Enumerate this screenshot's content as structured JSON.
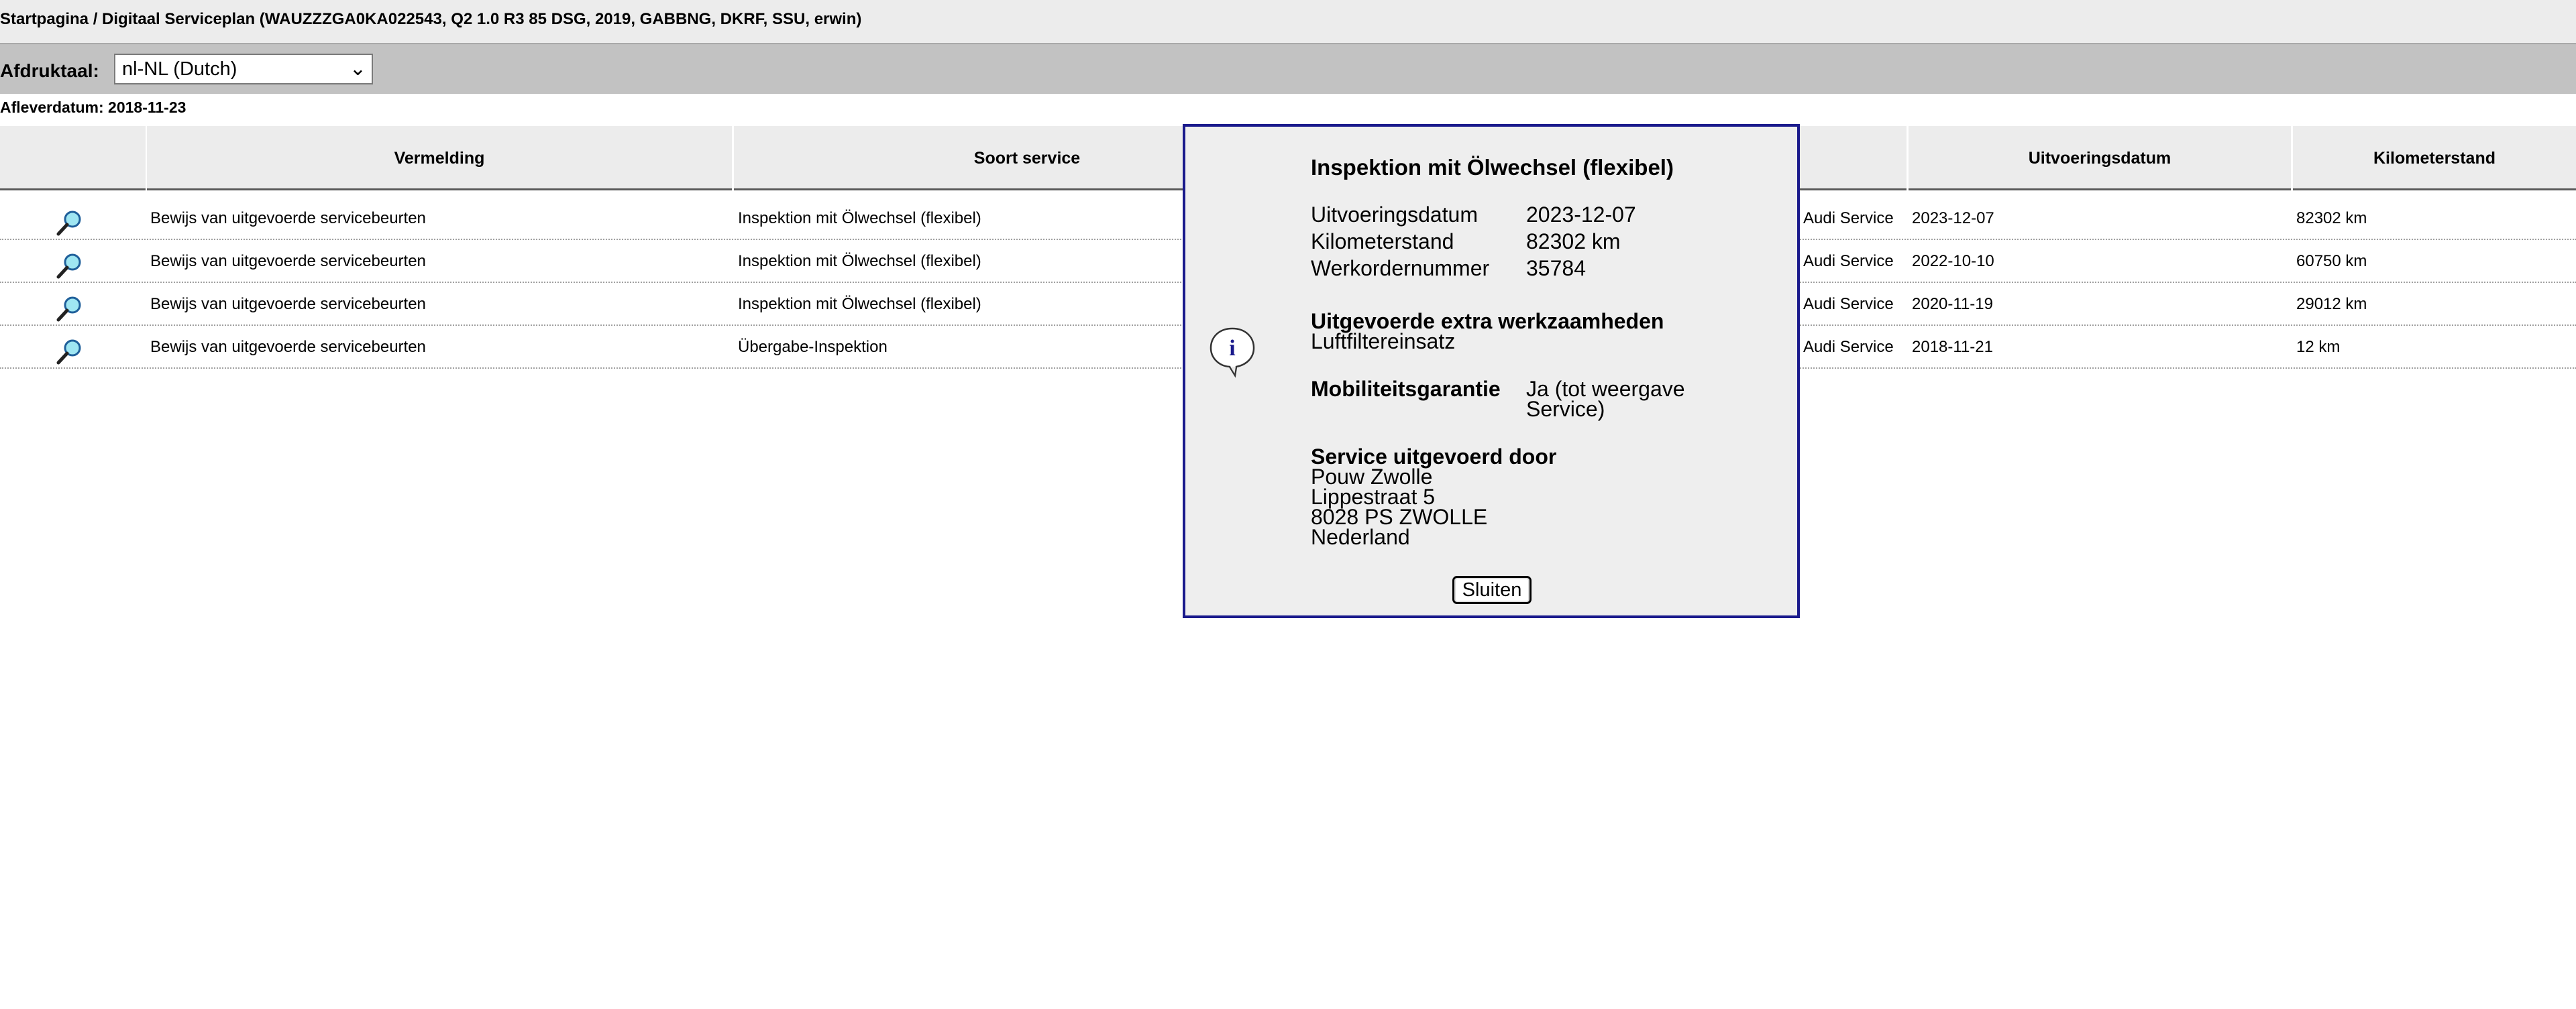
{
  "header": {
    "breadcrumb": "Startpagina / Digitaal Serviceplan (WAUZZZGA0KA022543, Q2 1.0 R3 85 DSG, 2019, GABBNG, DKRF, SSU, erwin)"
  },
  "language": {
    "label": "Afdruktaal:",
    "selected": "nl-NL (Dutch)"
  },
  "delivery": {
    "text": "Afleverdatum: 2018-11-23"
  },
  "table": {
    "columns": [
      "",
      "Vermelding",
      "Soort service",
      "",
      "Uitvoeringsdatum",
      "Kilometerstand"
    ],
    "rows": [
      {
        "vermelding": "Bewijs van uitgevoerde servicebeurten",
        "soort": "Inspektion mit Ölwechsel (flexibel)",
        "uitgevoerd": "Audi Service",
        "datum": "2023-12-07",
        "km": "82302 km"
      },
      {
        "vermelding": "Bewijs van uitgevoerde servicebeurten",
        "soort": "Inspektion mit Ölwechsel (flexibel)",
        "uitgevoerd": "Audi Service",
        "datum": "2022-10-10",
        "km": "60750 km"
      },
      {
        "vermelding": "Bewijs van uitgevoerde servicebeurten",
        "soort": "Inspektion mit Ölwechsel (flexibel)",
        "uitgevoerd": "Audi Service",
        "datum": "2020-11-19",
        "km": "29012 km"
      },
      {
        "vermelding": "Bewijs van uitgevoerde servicebeurten",
        "soort": "Übergabe-Inspektion",
        "uitgevoerd": "Audi Service",
        "datum": "2018-11-21",
        "km": "12 km"
      }
    ]
  },
  "dialog": {
    "title": "Inspektion mit Ölwechsel (flexibel)",
    "fields": [
      {
        "label": "Uitvoeringsdatum",
        "value": "2023-12-07"
      },
      {
        "label": "Kilometerstand",
        "value": "82302 km"
      },
      {
        "label": "Werkordernummer",
        "value": "35784"
      }
    ],
    "extra_heading": "Uitgevoerde extra werkzaamheden",
    "extra_value": "Luftfiltereinsatz",
    "mobility_label": "Mobiliteitsgarantie",
    "mobility_value_line1": "Ja (tot weergave",
    "mobility_value_line2": "Service)",
    "service_heading": "Service uitgevoerd door",
    "address": [
      "Pouw Zwolle",
      "Lippestraat 5",
      "8028 PS ZWOLLE",
      "Nederland"
    ],
    "close_label": "Sluiten"
  },
  "icons": {
    "row_details": "magnifier-icon",
    "dialog_info": "info-icon"
  },
  "colors": {
    "dialog_border": "#1a1a8c",
    "header_background": "#ececec",
    "language_bar": "#c2c2c2"
  }
}
